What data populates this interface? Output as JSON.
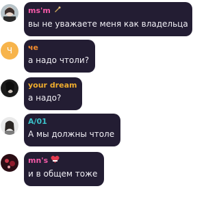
{
  "colors": {
    "bubble": "#231d33",
    "message_text": "#f2f0f6",
    "sender_pink": "#f45aa8",
    "sender_orange": "#f28b2e",
    "sender_gold": "#efac2d",
    "sender_teal": "#3bc1c9",
    "avatar_orange": "#f7b44c"
  },
  "messages": [
    {
      "sender": "ms'm",
      "sender_emoji": "sparkle-gun-icon",
      "text": "вы не уважаете меня как владельца",
      "avatar": "photo-avatar"
    },
    {
      "sender": "че",
      "avatar_letter": "Ч",
      "text": "а надо чтоли?"
    },
    {
      "sender": "your dream",
      "text": "а надо?",
      "avatar": "photo-avatar"
    },
    {
      "sender": "A/01",
      "text": "А мы должны чтоле",
      "avatar": "photo-avatar"
    },
    {
      "sender": "mn's",
      "sender_emoji": "heart-icon",
      "text": "и в общем тоже",
      "avatar": "photo-avatar"
    }
  ]
}
